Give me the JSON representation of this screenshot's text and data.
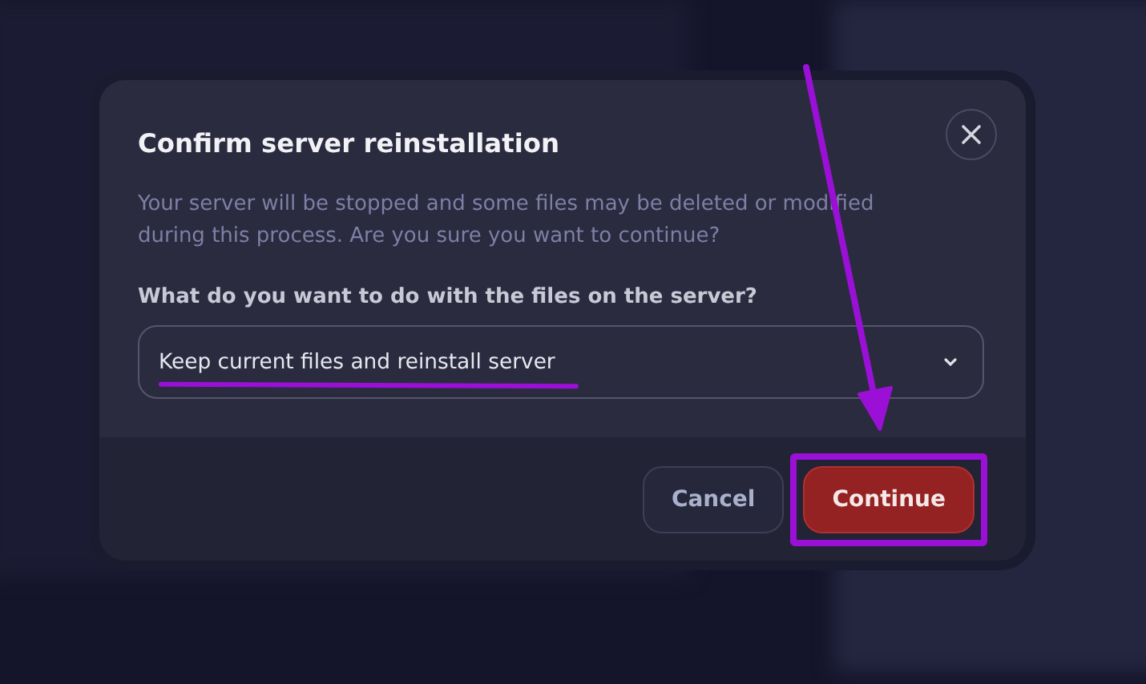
{
  "dialog": {
    "title": "Confirm server reinstallation",
    "message": "Your server will be stopped and some files may be deleted or modified during this process. Are you sure you want to continue?",
    "question": "What do you want to do with the files on the server?",
    "select": {
      "value": "Keep current files and reinstall server"
    },
    "buttons": [
      {
        "label": "Cancel",
        "kind": "secondary"
      },
      {
        "label": "Continue",
        "kind": "danger"
      }
    ]
  }
}
